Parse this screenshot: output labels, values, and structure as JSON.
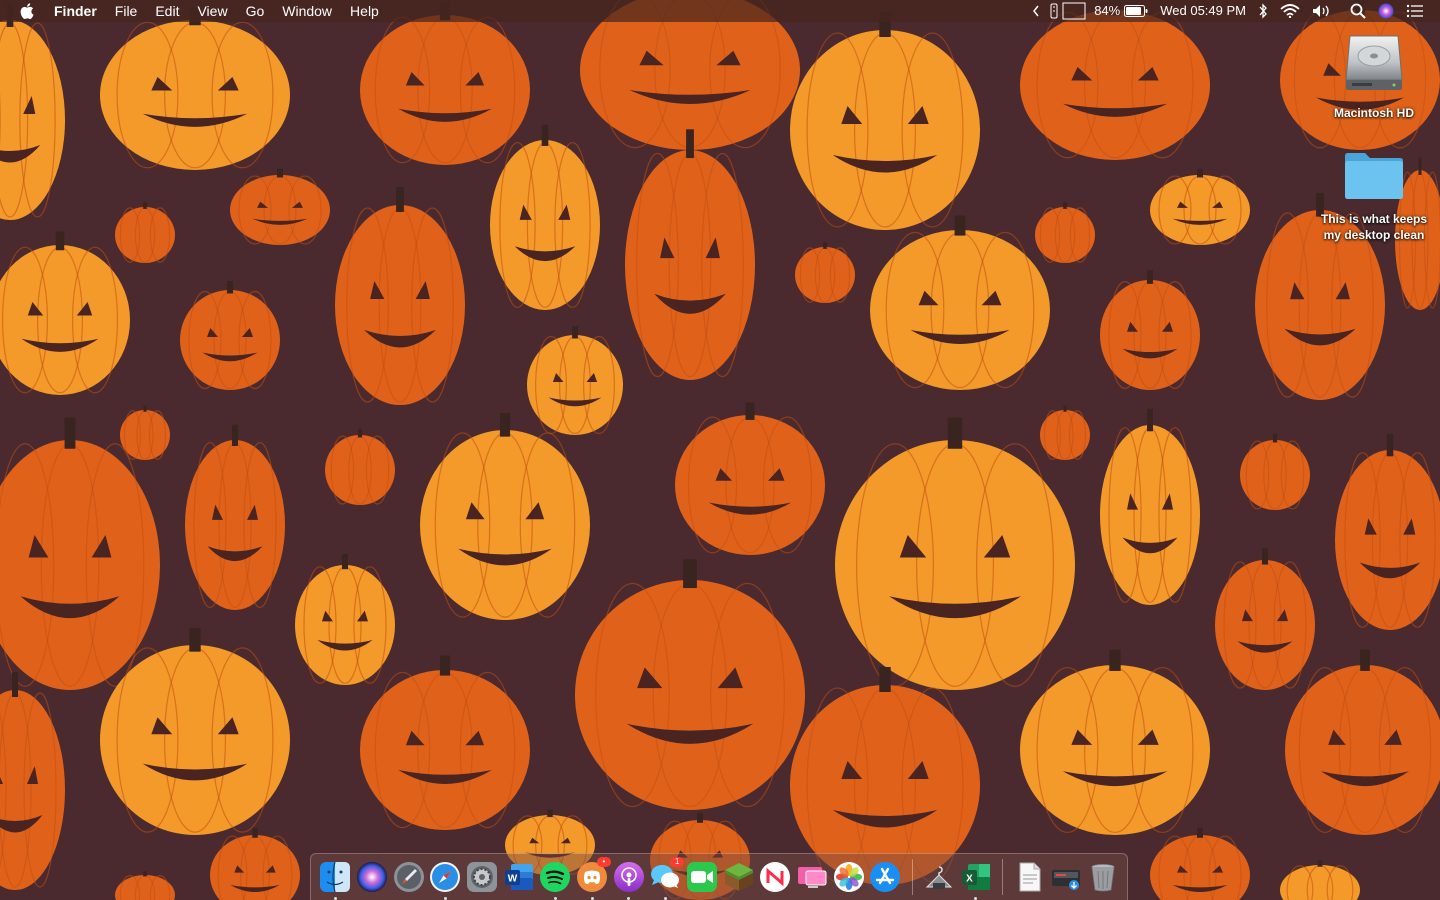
{
  "menubar": {
    "app_name": "Finder",
    "menus": [
      "File",
      "Edit",
      "View",
      "Go",
      "Window",
      "Help"
    ],
    "status": {
      "battery_percent": "84%",
      "clock": "Wed 05:49 PM",
      "icons": [
        "chevron-left-icon",
        "clipboard-icon",
        "box-icon",
        "battery-icon",
        "bluetooth-icon",
        "wifi-icon",
        "volume-icon",
        "search-icon",
        "siri-icon",
        "list-icon"
      ]
    }
  },
  "desktop": {
    "icons": [
      {
        "label": "Macintosh HD",
        "icon": "hard-drive-icon"
      },
      {
        "label": "This is what keeps my desktop clean",
        "icon": "folder-icon"
      }
    ]
  },
  "dock": {
    "apps": [
      {
        "name": "Finder",
        "icon": "finder-icon",
        "running": true
      },
      {
        "name": "Siri",
        "icon": "siri-icon",
        "running": false
      },
      {
        "name": "Launchpad",
        "icon": "launchpad-icon",
        "running": false
      },
      {
        "name": "Safari",
        "icon": "safari-icon",
        "running": true
      },
      {
        "name": "System Preferences",
        "icon": "system-preferences-icon",
        "running": false
      },
      {
        "name": "Word",
        "icon": "word-icon",
        "running": false
      },
      {
        "name": "Spotify",
        "icon": "spotify-icon",
        "running": true
      },
      {
        "name": "Discord",
        "icon": "discord-icon",
        "running": true,
        "badge": "•"
      },
      {
        "name": "Podcasts",
        "icon": "podcasts-icon",
        "running": true
      },
      {
        "name": "Messages",
        "icon": "messages-icon",
        "running": true,
        "badge": "1"
      },
      {
        "name": "FaceTime",
        "icon": "facetime-icon",
        "running": false
      },
      {
        "name": "Minecraft",
        "icon": "minecraft-icon",
        "running": false
      },
      {
        "name": "News",
        "icon": "news-icon",
        "running": false
      },
      {
        "name": "Sidecar",
        "icon": "display-icon",
        "running": false
      },
      {
        "name": "Photos",
        "icon": "photos-icon",
        "running": false
      },
      {
        "name": "App Store",
        "icon": "app-store-icon",
        "running": false
      },
      {
        "name": "Activity",
        "icon": "hanger-icon",
        "running": false
      },
      {
        "name": "Excel",
        "icon": "excel-icon",
        "running": true
      }
    ],
    "stack_items": [
      {
        "name": "Document",
        "icon": "document-icon"
      },
      {
        "name": "Downloads",
        "icon": "downloads-stack-icon"
      },
      {
        "name": "Trash",
        "icon": "trash-icon"
      }
    ],
    "word_letter": "W",
    "excel_letter": "X"
  },
  "colors": {
    "wallpaper_bg": "#4a2a2e",
    "pumpkin_dark": "#e0621a",
    "pumpkin_light": "#f39a2a",
    "stem": "#3a2420",
    "folder_blue": "#5db7e8"
  }
}
